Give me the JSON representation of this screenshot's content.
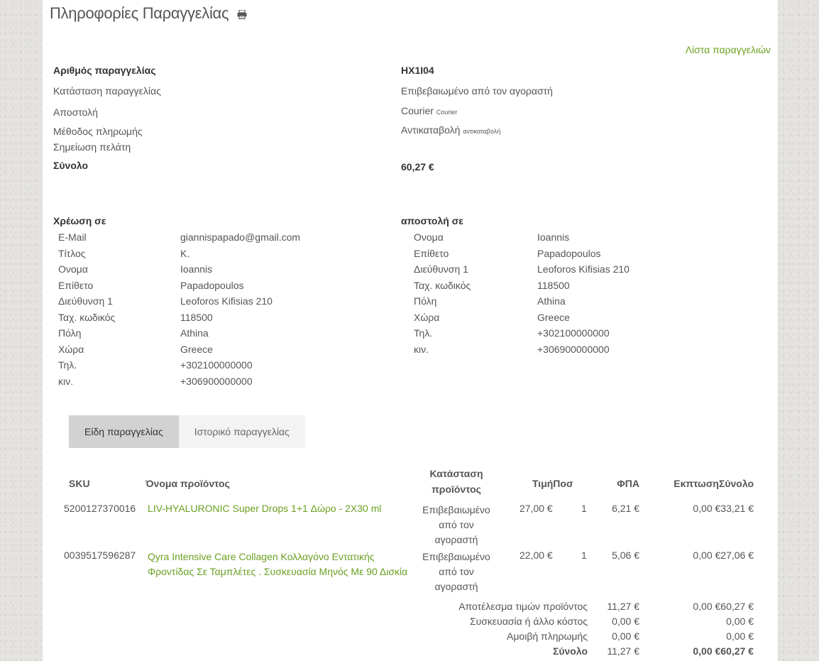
{
  "header": {
    "title": "Πληροφορίες Παραγγελίας",
    "print_icon": "printer-icon",
    "orders_link": "Λίστα παραγγελιών"
  },
  "order": {
    "number_label": "Αριθμός παραγγελίας",
    "number_value": "HX1I04",
    "status_label": "Κατάσταση παραγγελίας",
    "status_value": "Επιβεβαιωμένο από τον αγοραστή",
    "shipping_label": "Αποστολή",
    "shipping_value": "Courier",
    "shipping_small": "Courier",
    "payment_label": "Μέθοδος πληρωμής",
    "payment_value": "Αντικαταβολή",
    "payment_small": "αντικαταβολή",
    "note_label": "Σημείωση πελάτη",
    "total_label": "Σύνολο",
    "total_value": "60,27 €"
  },
  "billing": {
    "heading": "Χρέωση σε",
    "labels": [
      "E-Mail",
      "Τίτλος",
      "Ονομα",
      "Επίθετο",
      "Διεύθυνση 1",
      "Ταχ. κωδικός",
      "Πόλη",
      "Χώρα",
      "Τηλ.",
      "κιν."
    ],
    "values": [
      "giannispapado@gmail.com",
      "Κ.",
      "Ioannis",
      "Papadopoulos",
      "Leoforos Kifisias 210",
      "118500",
      "Athina",
      "Greece",
      "+302100000000",
      "+306900000000"
    ]
  },
  "shipto": {
    "heading": "αποστολή σε",
    "labels": [
      "Ονομα",
      "Επίθετο",
      "Διεύθυνση 1",
      "Ταχ. κωδικός",
      "Πόλη",
      "Χώρα",
      "Τηλ.",
      "κιν."
    ],
    "values": [
      "Ioannis",
      "Papadopoulos",
      "Leoforos Kifisias 210",
      "118500",
      "Athina",
      "Greece",
      "+302100000000",
      "+306900000000"
    ]
  },
  "tabs": [
    "Είδη παραγγελίας",
    "Ιστορικό παραγγελίας"
  ],
  "table": {
    "headers": {
      "sku": "SKU",
      "name": "Όνομα προϊόντος",
      "status_1": "Κατάσταση",
      "status_2": "προϊόντος",
      "price_qty": "ΤιμήΠοσ",
      "vat": "ΦΠΑ",
      "disc_total": "ΕκπτωσηΣύνολο"
    },
    "rows": [
      {
        "sku": "5200127370016",
        "name_1": "LIV-HYALURONIC Super Drops 1+1 Δώρο - 2Χ30 ml",
        "name_2": "",
        "status_1": "Επιβεβαιωμένο",
        "status_2": "από τον",
        "status_3": "αγοραστή",
        "price": "27,00 €",
        "qty": "1",
        "vat": "6,21 €",
        "disc_total": "0,00 €33,21 €"
      },
      {
        "sku": "0039517596287",
        "name_1": "Qyra Intensive Care Collagen Κολλαγόνο Εντατικής",
        "name_2": "Φροντίδας Σε Ταμπλέτες . Συσκευασία Μηνός Με 90 Δισκία",
        "status_1": "Επιβεβαιωμένο",
        "status_2": "από τον",
        "status_3": "αγοραστή",
        "price": "22,00 €",
        "qty": "1",
        "vat": "5,06 €",
        "disc_total": "0,00 €27,06 €"
      }
    ],
    "summary": [
      {
        "label": "Αποτέλεσμα τιμών προϊόντος",
        "vat": "11,27 €",
        "disc_total": "0,00 €60,27 €"
      },
      {
        "label": "Συσκευασία ή άλλο κόστος",
        "vat": "0,00 €",
        "disc_total": "0,00 €"
      },
      {
        "label": "Αμοιβή πληρωμής",
        "vat": "0,00 €",
        "disc_total": "0,00 €"
      },
      {
        "label": "Σύνολο",
        "vat": "11,27 €",
        "disc_total": "0,00 €60,27 €"
      }
    ]
  }
}
